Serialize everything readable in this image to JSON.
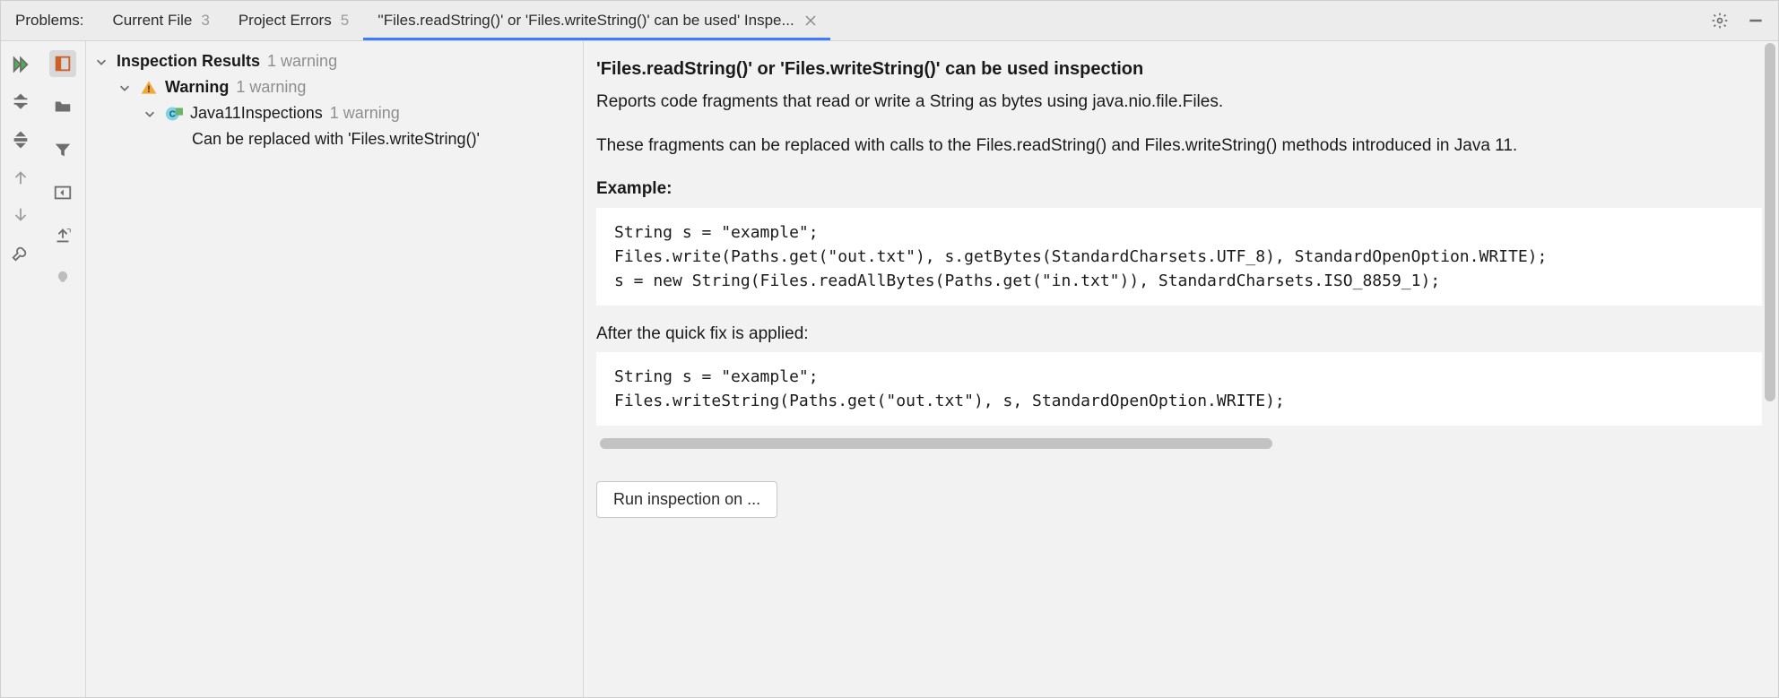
{
  "tabs": {
    "problems_label": "Problems:",
    "current_file_label": "Current File",
    "current_file_count": "3",
    "project_errors_label": "Project Errors",
    "project_errors_count": "5",
    "inspection_tab_label": "''Files.readString()' or 'Files.writeString()' can be used' Inspe..."
  },
  "tree": {
    "root_label": "Inspection Results",
    "root_count": "1 warning",
    "warning_label": "Warning",
    "warning_count": "1 warning",
    "class_label": "Java11Inspections",
    "class_count": "1 warning",
    "leaf_label": "Can be replaced with 'Files.writeString()'"
  },
  "detail": {
    "title": "'Files.readString()' or 'Files.writeString()' can be used inspection",
    "p1": "Reports code fragments that read or write a String as bytes using java.nio.file.Files.",
    "p2": "These fragments can be replaced with calls to the Files.readString() and Files.writeString() methods introduced in Java 11.",
    "example_label": "Example:",
    "code1": "String s = \"example\";\nFiles.write(Paths.get(\"out.txt\"), s.getBytes(StandardCharsets.UTF_8), StandardOpenOption.WRITE);\ns = new String(Files.readAllBytes(Paths.get(\"in.txt\")), StandardCharsets.ISO_8859_1);",
    "after_label": "After the quick fix is applied:",
    "code2": "String s = \"example\";\nFiles.writeString(Paths.get(\"out.txt\"), s, StandardOpenOption.WRITE);",
    "run_button": "Run inspection on ..."
  },
  "icons": {
    "gear": "gear-icon",
    "minimize": "minimize-icon",
    "close": "close-icon",
    "rerun": "rerun-icon",
    "highlight": "highlight-icon",
    "expand_all": "expand-all-icon",
    "folder": "folder-icon",
    "collapse_all": "collapse-all-icon",
    "filter": "filter-icon",
    "prev": "prev-icon",
    "preview": "preview-panel-icon",
    "next": "next-icon",
    "export": "export-icon",
    "wrench": "wrench-icon",
    "bulb": "bulb-icon"
  }
}
